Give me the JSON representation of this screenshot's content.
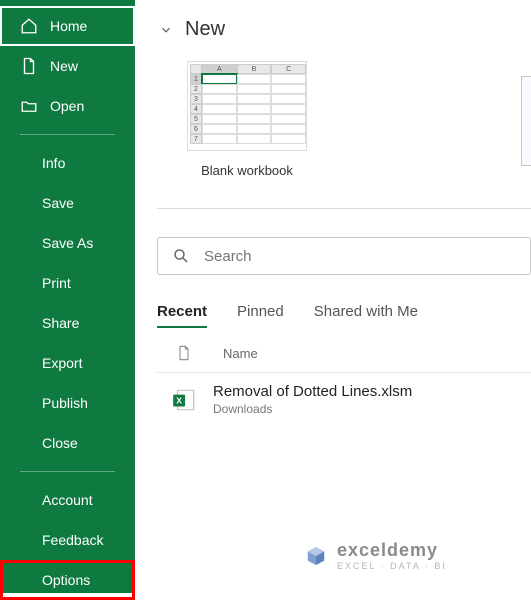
{
  "sidebar": {
    "home": "Home",
    "new": "New",
    "open": "Open",
    "info": "Info",
    "save": "Save",
    "saveAs": "Save As",
    "print": "Print",
    "share": "Share",
    "export": "Export",
    "publish": "Publish",
    "close": "Close",
    "account": "Account",
    "feedback": "Feedback",
    "options": "Options"
  },
  "main": {
    "sectionTitle": "New",
    "template": {
      "label": "Blank workbook"
    },
    "search": {
      "placeholder": "Search"
    },
    "tabs": {
      "recent": "Recent",
      "pinned": "Pinned",
      "shared": "Shared with Me"
    },
    "fileHeader": {
      "name": "Name"
    },
    "files": [
      {
        "name": "Removal of Dotted Lines.xlsm",
        "path": "Downloads"
      }
    ]
  },
  "watermark": {
    "brand": "exceldemy",
    "tagline": "EXCEL · DATA · BI"
  }
}
